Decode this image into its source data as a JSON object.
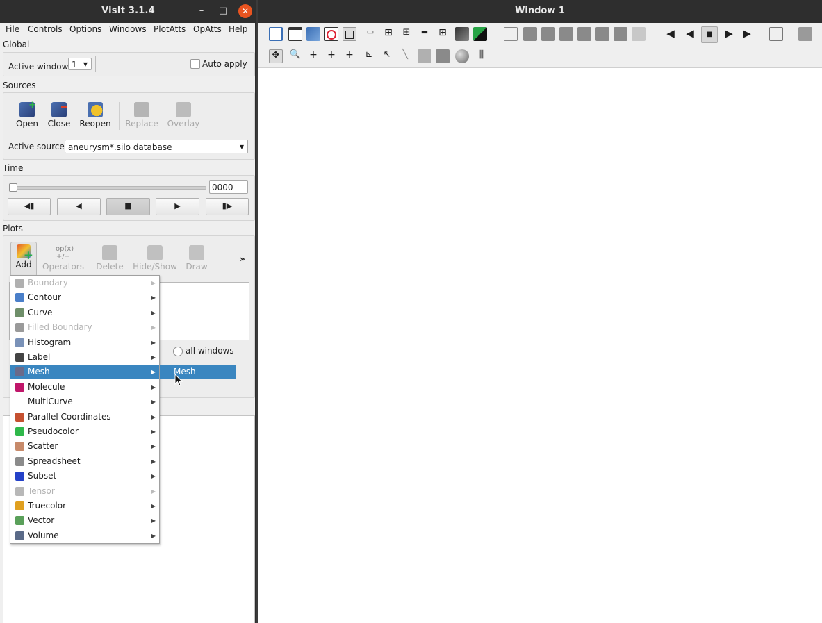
{
  "left_window": {
    "title": "VisIt 3.1.4",
    "controls": {
      "minimize": "–",
      "maximize": "□",
      "close": "✕"
    }
  },
  "menubar": [
    "File",
    "Controls",
    "Options",
    "Windows",
    "PlotAtts",
    "OpAtts",
    "Help"
  ],
  "global": {
    "label": "Global",
    "active_window_label": "Active window",
    "active_window_value": "1",
    "auto_apply_label": "Auto apply"
  },
  "sources": {
    "label": "Sources",
    "buttons": [
      {
        "label": "Open",
        "icon": "open-database-icon",
        "enabled": true
      },
      {
        "label": "Close",
        "icon": "close-database-icon",
        "enabled": true
      },
      {
        "label": "Reopen",
        "icon": "reopen-database-icon",
        "enabled": true
      },
      {
        "label": "Replace",
        "icon": "replace-database-icon",
        "enabled": false
      },
      {
        "label": "Overlay",
        "icon": "overlay-database-icon",
        "enabled": false
      }
    ],
    "active_source_label": "Active source",
    "active_source_value": "aneurysm*.silo database"
  },
  "time": {
    "label": "Time",
    "frame_value": "0000",
    "slider_fraction": 0,
    "buttons": [
      "◀▮",
      "◀",
      "■",
      "▶",
      "▮▶"
    ]
  },
  "plots": {
    "label": "Plots",
    "buttons": [
      {
        "label": "Add",
        "icon": "add-plot-icon",
        "enabled": true
      },
      {
        "label": "Operators",
        "icon": "operators-icon",
        "enabled": false
      },
      {
        "label": "Delete",
        "icon": "delete-plot-icon",
        "enabled": false
      },
      {
        "label": "Hide/Show",
        "icon": "hide-show-icon",
        "enabled": false
      },
      {
        "label": "Draw",
        "icon": "draw-icon",
        "enabled": false
      }
    ],
    "more": "»",
    "all_windows_label": "all windows"
  },
  "add_menu": {
    "items": [
      {
        "label": "Boundary",
        "enabled": false,
        "color": "#b0b0b0"
      },
      {
        "label": "Contour",
        "enabled": true,
        "color": "#4a7fc9"
      },
      {
        "label": "Curve",
        "enabled": true,
        "color": "#6f8f6a"
      },
      {
        "label": "Filled Boundary",
        "enabled": false,
        "color": "#9a9a9a"
      },
      {
        "label": "Histogram",
        "enabled": true,
        "color": "#7a92b8"
      },
      {
        "label": "Label",
        "enabled": true,
        "color": "#444444"
      },
      {
        "label": "Mesh",
        "enabled": true,
        "color": "#6a6a8a",
        "selected": true
      },
      {
        "label": "Molecule",
        "enabled": true,
        "color": "#c0166a"
      },
      {
        "label": "MultiCurve",
        "enabled": true,
        "color": ""
      },
      {
        "label": "Parallel Coordinates",
        "enabled": true,
        "color": "#c55030"
      },
      {
        "label": "Pseudocolor",
        "enabled": true,
        "color": "#2fb84a"
      },
      {
        "label": "Scatter",
        "enabled": true,
        "color": "#c78a6a"
      },
      {
        "label": "Spreadsheet",
        "enabled": true,
        "color": "#8b8b8b"
      },
      {
        "label": "Subset",
        "enabled": true,
        "color": "#2441c8"
      },
      {
        "label": "Tensor",
        "enabled": false,
        "color": "#b8b8b8"
      },
      {
        "label": "Truecolor",
        "enabled": true,
        "color": "#e0a020"
      },
      {
        "label": "Vector",
        "enabled": true,
        "color": "#5aa05a"
      },
      {
        "label": "Volume",
        "enabled": true,
        "color": "#5a6a88"
      }
    ],
    "submenu_item": "Mesh"
  },
  "right_window": {
    "title": "Window 1",
    "minimize": "–"
  }
}
